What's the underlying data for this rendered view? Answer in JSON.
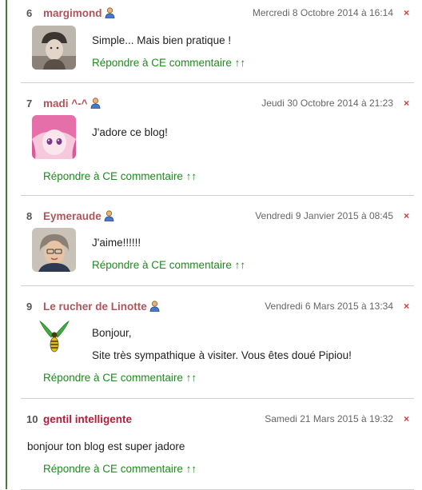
{
  "comments": [
    {
      "num": "6",
      "author": "margimond",
      "date": "Mercredi 8 Octobre 2014 à 16:14",
      "lines": [
        "Simple... Mais bien pratique !"
      ],
      "reply": "Répondre à CE commentaire ↑↑"
    },
    {
      "num": "7",
      "author": "madi ^-^",
      "date": "Jeudi 30 Octobre 2014 à 21:23",
      "lines": [
        "J'adore ce blog!"
      ],
      "reply": "Répondre à CE commentaire ↑↑"
    },
    {
      "num": "8",
      "author": "Eymeraude",
      "date": "Vendredi 9 Janvier 2015 à 08:45",
      "lines": [
        "J'aime!!!!!!"
      ],
      "reply": "Répondre à CE commentaire ↑↑"
    },
    {
      "num": "9",
      "author": "Le rucher de Linotte",
      "date": "Vendredi 6 Mars 2015 à 13:34",
      "lines": [
        "Bonjour,",
        "Site très sympathique à visiter. Vous êtes doué Pipiou!"
      ],
      "reply": "Répondre à CE commentaire ↑↑"
    },
    {
      "num": "10",
      "author": "gentil intelligente",
      "date": "Samedi 21 Mars 2015 à 19:32",
      "lines": [
        "bonjour ton blog est super jadore"
      ],
      "reply": "Répondre à CE commentaire ↑↑"
    }
  ],
  "delete_glyph": "×",
  "icons": {
    "user": "user-icon",
    "delete": "close-icon"
  },
  "colors": {
    "author": "#b0545a",
    "author_alt": "#b21e3a",
    "reply": "#1f8a1f",
    "delete": "#dd3333",
    "rail": "#4a7a3a"
  }
}
